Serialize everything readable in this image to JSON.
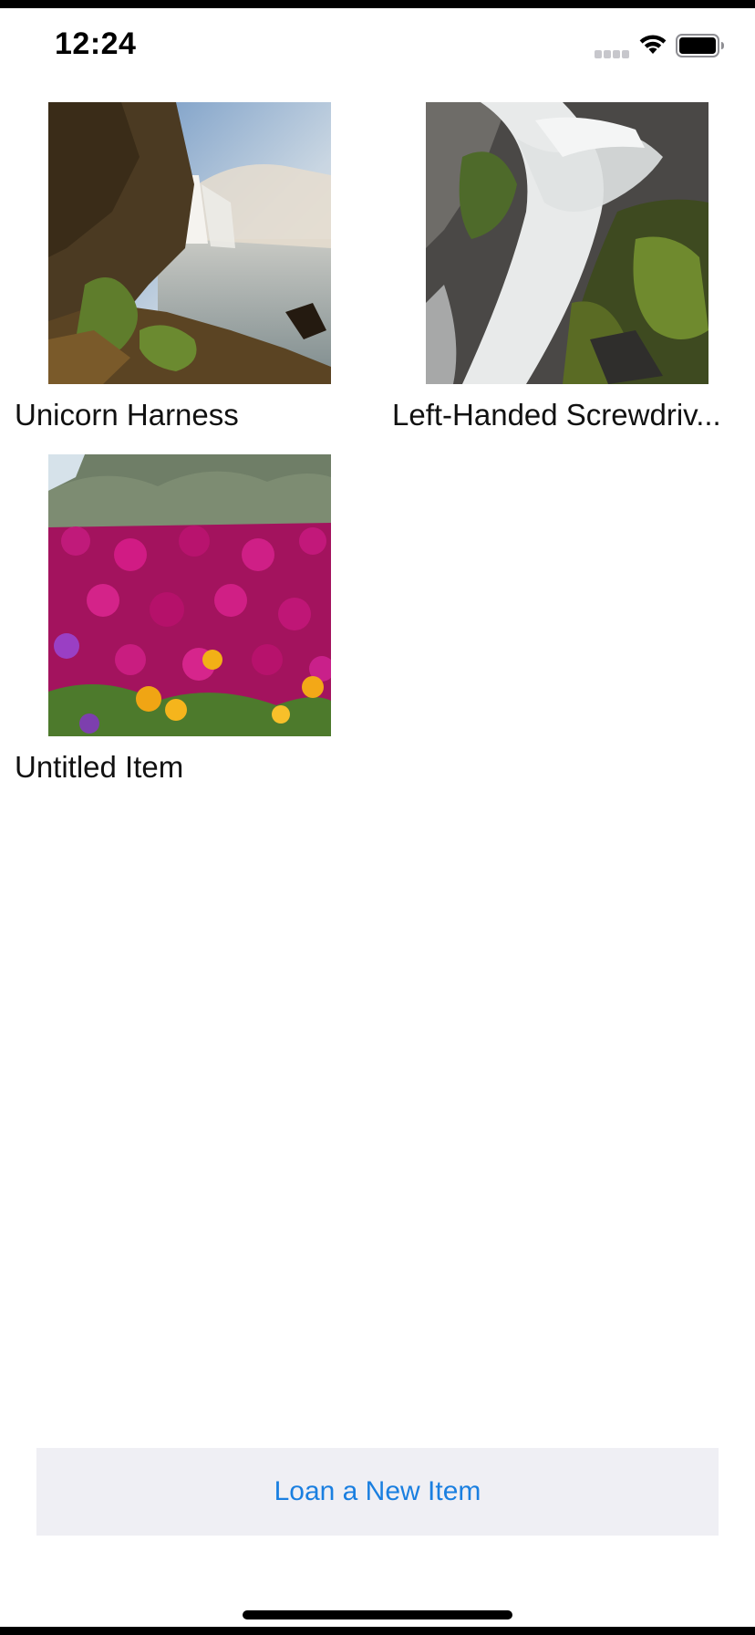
{
  "status_bar": {
    "time": "12:24",
    "signal_icon": "cellular-signal-icon",
    "wifi_icon": "wifi-icon",
    "battery_icon": "battery-icon"
  },
  "items": [
    {
      "label": "Unicorn Harness",
      "image": "waterfall-cliff-photo"
    },
    {
      "label": "Left-Handed Screwdriv...",
      "image": "waterfall-rocks-photo"
    },
    {
      "label": "Untitled Item",
      "image": "pink-flowers-photo"
    }
  ],
  "loan_button": {
    "label": "Loan a New Item",
    "color": "#1a7fe0",
    "background": "#efeff4"
  }
}
